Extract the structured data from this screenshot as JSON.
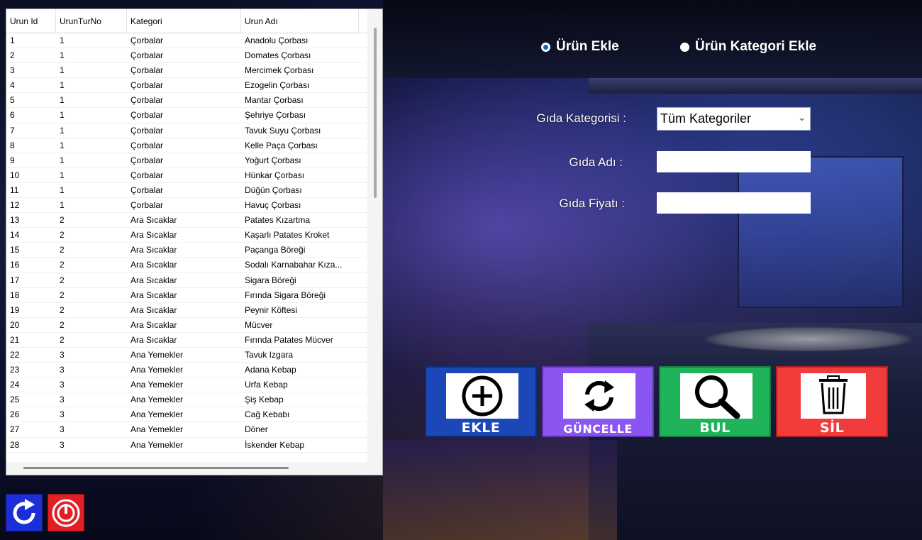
{
  "grid": {
    "columns": [
      "Urun Id",
      "UrunTurNo",
      "Kategori",
      "Urun Adı"
    ],
    "rows": [
      [
        "1",
        "1",
        "Çorbalar",
        " Anadolu Çorbası"
      ],
      [
        "2",
        "1",
        "Çorbalar",
        "Domates Çorbası"
      ],
      [
        "3",
        "1",
        "Çorbalar",
        "Mercimek Çorbası"
      ],
      [
        "4",
        "1",
        "Çorbalar",
        "Ezogelin Çorbası"
      ],
      [
        "5",
        "1",
        "Çorbalar",
        "Mantar Çorbası"
      ],
      [
        "6",
        "1",
        "Çorbalar",
        "Şehriye Çorbası"
      ],
      [
        "7",
        "1",
        "Çorbalar",
        "Tavuk Suyu Çorbası"
      ],
      [
        "8",
        "1",
        "Çorbalar",
        "Kelle Paça Çorbası"
      ],
      [
        "9",
        "1",
        "Çorbalar",
        "Yoğurt Çorbası"
      ],
      [
        "10",
        "1",
        "Çorbalar",
        "Hünkar Çorbası"
      ],
      [
        "11",
        "1",
        "Çorbalar",
        "Düğün Çorbası"
      ],
      [
        "12",
        "1",
        "Çorbalar",
        "Havuç Çorbası"
      ],
      [
        "13",
        "2",
        "Ara Sıcaklar",
        "Patates Kızartma"
      ],
      [
        "14",
        "2",
        "Ara Sıcaklar",
        "Kaşarlı Patates Kroket"
      ],
      [
        "15",
        "2",
        "Ara Sıcaklar",
        "Paçanga Böreği"
      ],
      [
        "16",
        "2",
        "Ara Sıcaklar",
        "Sodalı Karnabahar Kıza..."
      ],
      [
        "17",
        "2",
        "Ara Sıcaklar",
        "Sigara Böreği"
      ],
      [
        "18",
        "2",
        "Ara Sıcaklar",
        "Fırında Sigara Böreği"
      ],
      [
        "19",
        "2",
        "Ara Sıcaklar",
        "Peynir Köftesi"
      ],
      [
        "20",
        "2",
        "Ara Sıcaklar",
        "Mücver"
      ],
      [
        "21",
        "2",
        "Ara Sıcaklar",
        "Fırında Patates Mücver"
      ],
      [
        "22",
        "3",
        "Ana Yemekler",
        "Tavuk Izgara"
      ],
      [
        "23",
        "3",
        "Ana Yemekler",
        "Adana Kebap"
      ],
      [
        "24",
        "3",
        "Ana Yemekler",
        "Urfa Kebap"
      ],
      [
        "25",
        "3",
        "Ana Yemekler",
        "Şiş Kebap"
      ],
      [
        "26",
        "3",
        "Ana Yemekler",
        "Cağ Kebabı"
      ],
      [
        "27",
        "3",
        "Ana Yemekler",
        "Döner"
      ],
      [
        "28",
        "3",
        "Ana Yemekler",
        "İskender Kebap"
      ]
    ]
  },
  "mode": {
    "option1": "Ürün Ekle",
    "option2": "Ürün Kategori Ekle",
    "selected": "option1"
  },
  "form": {
    "category_label": "Gıda Kategorisi :",
    "category_value": "Tüm Kategoriler",
    "name_label": "Gıda Adı :",
    "name_value": "",
    "price_label": "Gıda Fiyatı :",
    "price_value": ""
  },
  "actions": {
    "add": "EKLE",
    "update": "GÜNCELLE",
    "find": "BUL",
    "delete": "SİL"
  },
  "icons": {
    "add": "plus-circle-icon",
    "update": "refresh-arrows-icon",
    "find": "magnifier-icon",
    "delete": "trash-icon",
    "reload": "reload-icon",
    "power": "power-icon"
  },
  "colors": {
    "add": "#1b47b8",
    "update": "#8a55f0",
    "find": "#1fb35a",
    "delete": "#f23b3b",
    "radio_accent": "#1565c0"
  }
}
